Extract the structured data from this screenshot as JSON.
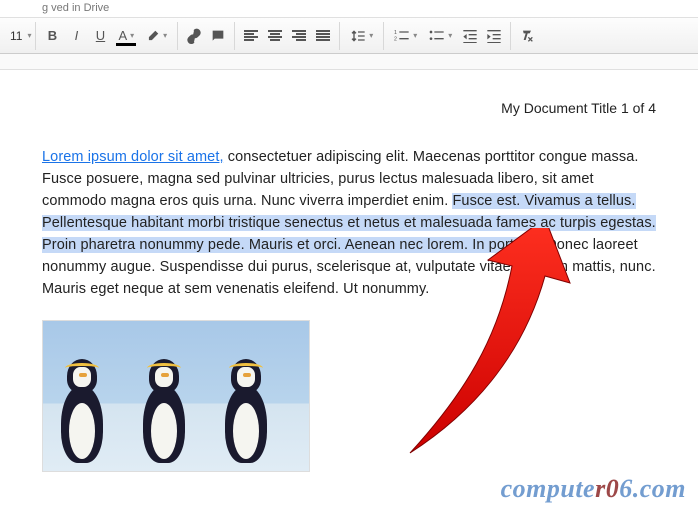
{
  "topbar": {
    "status_fragment": "g        ved in Drive"
  },
  "toolbar": {
    "font_size": "11",
    "bold": "B",
    "italic": "I",
    "underline": "U",
    "text_color": "A",
    "text_color_value": "#000000",
    "highlight_color_value": "#ffff00"
  },
  "document": {
    "header": "My Document Title 1 of 4",
    "link_text": "Lorem ipsum dolor sit amet,",
    "p1_pre": " consectetuer adipiscing elit. Maecenas porttitor congue massa. Fusce posuere, magna sed pulvinar ultricies, purus lectus malesuada libero, sit amet commodo magna eros quis urna. Nunc viverra imperdiet enim. ",
    "p1_sel": "Fusce est. Vivamus a tellus. Pellentesque habitant morbi tristique senectus et netus et malesuada fames ac turpis egestas. Proin pharetra nonummy pede. Mauris et orci. Aenean nec lorem. In porttitor.",
    "p1_post": " Donec laoreet nonummy augue. Suspendisse dui purus, scelerisque at, vulputate vitae, pretium mattis, nunc. Mauris eget neque at sem venenatis eleifend. Ut nonummy."
  },
  "watermark": {
    "pre": "compute",
    "hl": "r0",
    "post": "6.com"
  },
  "icons": {
    "dropdown": "▾",
    "link": "link-icon",
    "image": "image-icon",
    "align_left": "align-left-icon",
    "align_center": "align-center-icon",
    "align_right": "align-right-icon",
    "align_justify": "align-justify-icon",
    "line_spacing": "line-spacing-icon",
    "list_numbered": "list-numbered-icon",
    "list_bulleted": "list-bulleted-icon",
    "indent_decrease": "indent-decrease-icon",
    "indent_increase": "indent-increase-icon",
    "clear_format": "clear-format-icon"
  }
}
